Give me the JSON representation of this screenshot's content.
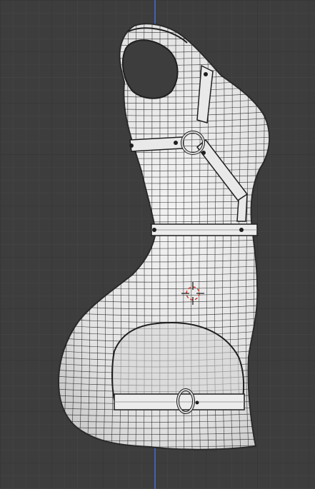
{
  "viewport": {
    "view": "side",
    "shading": "solid-wireframe",
    "colors": {
      "background": "#3d3d3d",
      "grid_minor": "#4a4a4a",
      "grid_major": "#2f2f2f",
      "axis_z": "#4a6fd6",
      "mesh_fill": "#e7e7e7",
      "mesh_shadow": "#c9c9c9",
      "wire": "#1e1e1e",
      "cursor": "#d0392b"
    },
    "grid_visible": true,
    "axis_visible": "z",
    "object": {
      "type": "garment-mesh",
      "parts": [
        "body-shell",
        "harness-strap-diagonal",
        "harness-strap-chest",
        "waist-belt",
        "o-ring-chest",
        "leg-belt",
        "o-ring-leg",
        "hip-cutout"
      ]
    },
    "cursor_icon": "3d-cursor-icon"
  }
}
